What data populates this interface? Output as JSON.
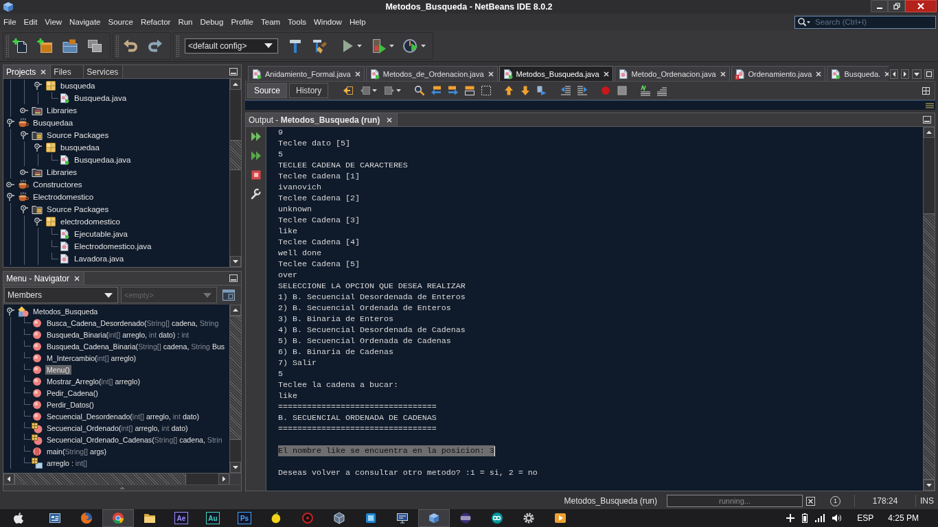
{
  "window": {
    "title": "Metodos_Busqueda - NetBeans IDE 8.0.2"
  },
  "menu": [
    "File",
    "Edit",
    "View",
    "Navigate",
    "Source",
    "Refactor",
    "Run",
    "Debug",
    "Profile",
    "Team",
    "Tools",
    "Window",
    "Help"
  ],
  "search": {
    "placeholder": "Search (Ctrl+I)"
  },
  "toolbar": {
    "config": "<default config>"
  },
  "projects_panel": {
    "tabs": [
      {
        "label": "Projects",
        "selected": true
      },
      {
        "label": "Files",
        "selected": false
      },
      {
        "label": "Services",
        "selected": false
      }
    ],
    "tree": [
      {
        "children": [
          {
            "children": [
              {
                "label": "busqueda",
                "kind": "package",
                "expanded": true,
                "children": [
                  {
                    "label": "Busqueda.java",
                    "kind": "main-class"
                  }
                ]
              }
            ]
          },
          {
            "label": "Libraries",
            "kind": "library",
            "expanded": false
          }
        ]
      },
      {
        "label": "Busquedaa",
        "kind": "project",
        "expanded": true,
        "children": [
          {
            "label": "Source Packages",
            "kind": "source-root",
            "expanded": true,
            "children": [
              {
                "label": "busquedaa",
                "kind": "package",
                "expanded": true,
                "children": [
                  {
                    "label": "Busquedaa.java",
                    "kind": "main-class"
                  }
                ]
              }
            ]
          },
          {
            "label": "Libraries",
            "kind": "library",
            "expanded": false
          }
        ]
      },
      {
        "label": "Constructores",
        "kind": "project",
        "expanded": false
      },
      {
        "label": "Electrodomestico",
        "kind": "project",
        "expanded": true,
        "children": [
          {
            "label": "Source Packages",
            "kind": "source-root",
            "expanded": true,
            "children": [
              {
                "label": "electrodomestico",
                "kind": "package",
                "expanded": true,
                "children": [
                  {
                    "label": "Ejecutable.java",
                    "kind": "main-class"
                  },
                  {
                    "label": "Electrodomestico.java",
                    "kind": "class"
                  },
                  {
                    "label": "Lavadora.java",
                    "kind": "class"
                  }
                ]
              }
            ]
          }
        ]
      }
    ]
  },
  "navigator": {
    "title": "Menu - Navigator",
    "filter": "Members",
    "secondary_filter": {
      "value": "<empty>",
      "disabled": true
    },
    "tree": [
      {
        "kind": "class",
        "expanded": true,
        "selected": false,
        "parts": [
          {
            "text": "Metodos_Busqueda",
            "muted": false
          }
        ],
        "children": [
          {
            "kind": "method",
            "selected": false,
            "parts": [
              {
                "text": "Busca_Cadena_Desordenado(",
                "muted": false
              },
              {
                "text": "String[]",
                "muted": true
              },
              {
                "text": " cadena, ",
                "muted": false
              },
              {
                "text": "String",
                "muted": true
              }
            ]
          },
          {
            "kind": "method",
            "selected": false,
            "parts": [
              {
                "text": "Busqueda_Binaria(",
                "muted": false
              },
              {
                "text": "int[]",
                "muted": true
              },
              {
                "text": " arreglo, ",
                "muted": false
              },
              {
                "text": "int",
                "muted": true
              },
              {
                "text": " dato) : ",
                "muted": false
              },
              {
                "text": "int",
                "muted": true
              }
            ]
          },
          {
            "kind": "method",
            "selected": false,
            "parts": [
              {
                "text": "Busqueda_Cadena_Binaria(",
                "muted": false
              },
              {
                "text": "String[]",
                "muted": true
              },
              {
                "text": " cadena, ",
                "muted": false
              },
              {
                "text": "String",
                "muted": true
              },
              {
                "text": " Bus",
                "muted": false
              }
            ]
          },
          {
            "kind": "method",
            "selected": false,
            "parts": [
              {
                "text": "M_Intercambio(",
                "muted": false
              },
              {
                "text": "int[]",
                "muted": true
              },
              {
                "text": " arreglo)",
                "muted": false
              }
            ]
          },
          {
            "kind": "method",
            "selected": true,
            "parts": [
              {
                "text": "Menu()",
                "muted": false
              }
            ]
          },
          {
            "kind": "method",
            "selected": false,
            "parts": [
              {
                "text": "Mostrar_Arreglo(",
                "muted": false
              },
              {
                "text": "int[]",
                "muted": true
              },
              {
                "text": " arreglo)",
                "muted": false
              }
            ]
          },
          {
            "kind": "method",
            "selected": false,
            "parts": [
              {
                "text": "Pedir_Cadena()",
                "muted": false
              }
            ]
          },
          {
            "kind": "method",
            "selected": false,
            "parts": [
              {
                "text": "Perdir_Datos()",
                "muted": false
              }
            ]
          },
          {
            "kind": "method",
            "selected": false,
            "parts": [
              {
                "text": "Secuencial_Desordenado(",
                "muted": false
              },
              {
                "text": "int[]",
                "muted": true
              },
              {
                "text": " arreglo, ",
                "muted": false
              },
              {
                "text": "int",
                "muted": true
              },
              {
                "text": " dato)",
                "muted": false
              }
            ]
          },
          {
            "kind": "static-method",
            "selected": false,
            "parts": [
              {
                "text": "Secuencial_Ordenado(",
                "muted": false
              },
              {
                "text": "int[]",
                "muted": true
              },
              {
                "text": " arreglo, ",
                "muted": false
              },
              {
                "text": "int",
                "muted": true
              },
              {
                "text": " dato)",
                "muted": false
              }
            ]
          },
          {
            "kind": "static-method",
            "selected": false,
            "parts": [
              {
                "text": "Secuencial_Ordenado_Cadenas(",
                "muted": false
              },
              {
                "text": "String[]",
                "muted": true
              },
              {
                "text": " cadena, ",
                "muted": false
              },
              {
                "text": "Strin",
                "muted": true
              }
            ]
          },
          {
            "kind": "main-method",
            "selected": false,
            "parts": [
              {
                "text": "main(",
                "muted": false
              },
              {
                "text": "String[]",
                "muted": true
              },
              {
                "text": " args)",
                "muted": false
              }
            ]
          },
          {
            "kind": "static-field",
            "selected": false,
            "parts": [
              {
                "text": "arreglo : ",
                "muted": false
              },
              {
                "text": "int[]",
                "muted": true
              }
            ]
          }
        ]
      }
    ]
  },
  "editor": {
    "tabs": [
      {
        "label": "Anidamiento_Formal.java",
        "kind": "main-class",
        "selected": false
      },
      {
        "label": "Metodos_de_Ordenacion.java",
        "kind": "main-class",
        "selected": false
      },
      {
        "label": "Metodos_Busqueda.java",
        "kind": "main-class",
        "selected": true
      },
      {
        "label": "Metodo_Ordenacion.java",
        "kind": "class",
        "selected": false
      },
      {
        "label": "Ordenamiento.java",
        "kind": "error-class",
        "selected": false
      },
      {
        "label": "Busqueda.",
        "kind": "main-class",
        "selected": false
      }
    ],
    "views": [
      {
        "label": "Source",
        "selected": true
      },
      {
        "label": "History",
        "selected": false
      }
    ]
  },
  "output": {
    "title": "Output - **Metodos_Busqueda (run)**",
    "blocks": [
      {
        "selected": false,
        "lines": [
          "9",
          "Teclee dato [5]",
          "5",
          "TECLEE CADENA DE CARACTERES",
          "Teclee Cadena [1]",
          "ivanovich",
          "Teclee Cadena [2]",
          "unknown",
          "Teclee Cadena [3]",
          "like",
          "Teclee Cadena [4]",
          "well done",
          "Teclee Cadena [5]",
          "over",
          "SELECCIONE LA OPCION QUE DESEA REALIZAR",
          "1) B. Secuencial Desordenada de Enteros",
          "2) B. Secuencial Ordenada de Enteros",
          "3) B. Binaria de Enteros",
          "4) B. Secuencial Desordenada de Cadenas",
          "5) B. Secuencial Ordenada de Cadenas",
          "6) B. Binaria de Cadenas",
          "7) Salir",
          "5",
          "Teclee la cadena a bucar:",
          "like",
          "=================================",
          "B. SECUENCIAL ORDENADA DE CADENAS",
          "================================="
        ]
      },
      {
        "selected": true,
        "lines": [
          "El nombre like se encuentra en la posicion: 3"
        ]
      },
      {
        "selected": false,
        "lines": [
          "Deseas volver a consultar otro metodo? :1 = si, 2 = no"
        ]
      }
    ]
  },
  "status_bar": {
    "task": "Metodos_Busqueda (run)",
    "progress": "running...",
    "notifications": "1",
    "position": "178:24",
    "mode": "INS"
  },
  "taskbar": {
    "apps": [
      {
        "kind": "window",
        "selected": false
      },
      {
        "kind": "globe",
        "selected": false
      },
      {
        "kind": "ring",
        "selected": true
      },
      {
        "kind": "folder",
        "selected": false
      },
      {
        "kind": "tile",
        "label": "Ae",
        "color": "#9d8cff",
        "selected": false
      },
      {
        "kind": "tile",
        "label": "Au",
        "color": "#3fd8b8",
        "selected": false
      },
      {
        "kind": "tile",
        "label": "Ps",
        "color": "#3ea8ff",
        "selected": false
      },
      {
        "kind": "fruit",
        "selected": false
      },
      {
        "kind": "disc",
        "selected": false
      },
      {
        "kind": "wire-cube",
        "selected": false
      },
      {
        "kind": "square",
        "selected": false
      },
      {
        "kind": "monitor",
        "selected": false
      },
      {
        "kind": "cube",
        "selected": true
      },
      {
        "kind": "sphere",
        "selected": false
      },
      {
        "kind": "infinity",
        "selected": false
      },
      {
        "kind": "gear",
        "selected": false
      },
      {
        "kind": "play",
        "selected": false
      }
    ],
    "language": "ESP",
    "time": "4:25 PM"
  }
}
